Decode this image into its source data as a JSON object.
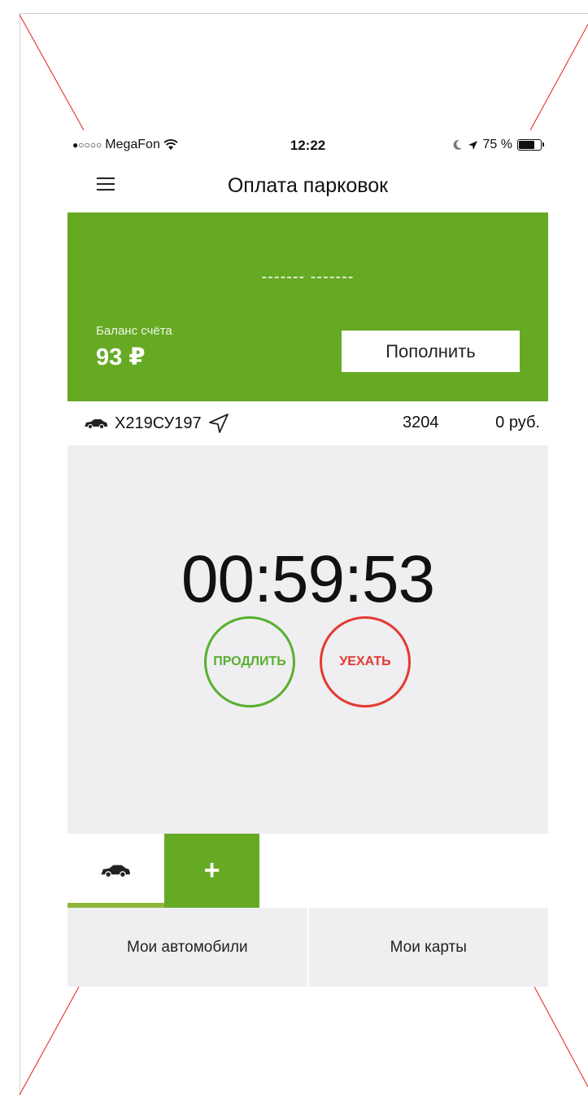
{
  "status_bar": {
    "carrier_signal": "●○○○○",
    "carrier": "MegaFon",
    "time": "12:22",
    "battery": "75 %",
    "battery_level": 0.75
  },
  "header": {
    "title": "Оплата парковок"
  },
  "balance": {
    "masked_number": "------- -------",
    "label": "Баланс счёта",
    "value": "93 ₽",
    "topup_label": "Пополнить"
  },
  "car_row": {
    "plate": "Х219СУ197",
    "zone": "3204",
    "cost": "0 руб."
  },
  "timer": {
    "value": "00:59:53",
    "extend_label": "ПРОДЛИТЬ",
    "leave_label": "УЕХАТЬ"
  },
  "tabs": {
    "add_label": "+"
  },
  "bottom": {
    "my_cars": "Мои автомобили",
    "my_cards": "Мои карты"
  },
  "colors": {
    "accent_green": "#66aa24",
    "extend_green": "#58b030",
    "leave_red": "#e33a32",
    "panel_gray": "#efeef1"
  }
}
